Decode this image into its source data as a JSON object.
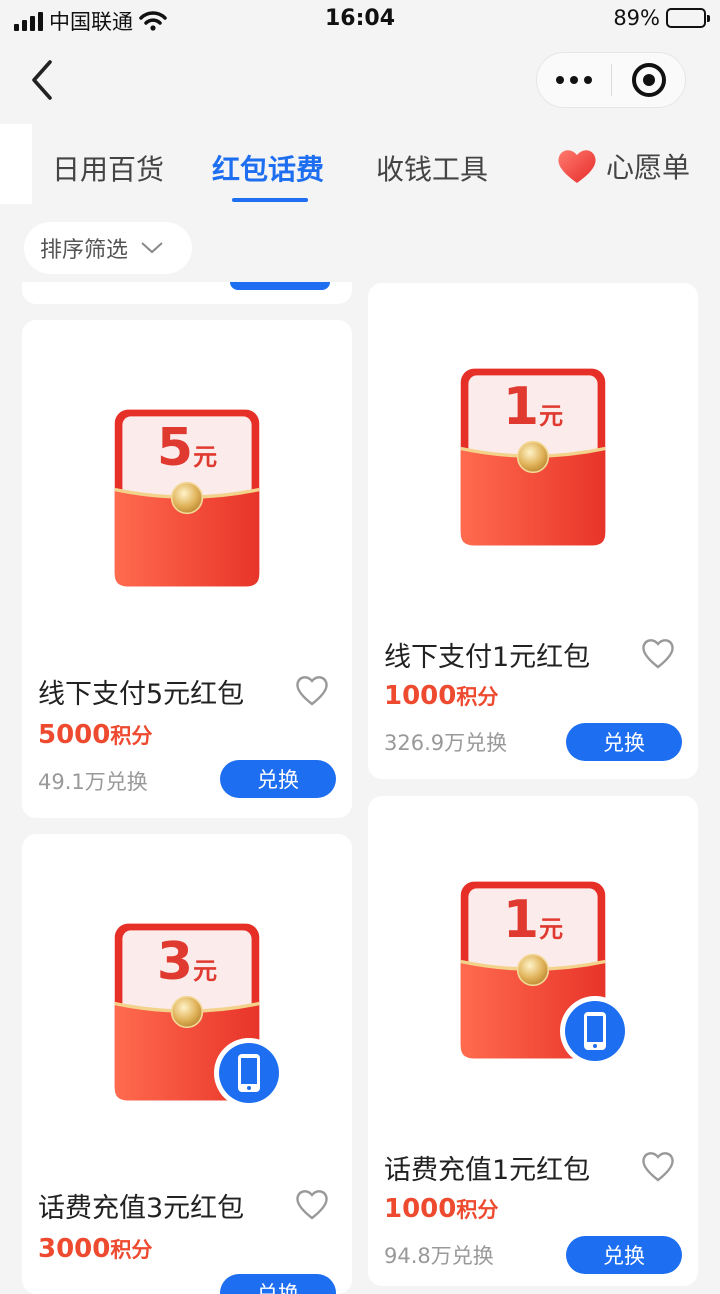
{
  "status": {
    "carrier": "中国联通",
    "time": "16:04",
    "battery": "89%"
  },
  "tabs": [
    {
      "label": "日用百货"
    },
    {
      "label": "红包话费"
    },
    {
      "label": "收钱工具"
    }
  ],
  "wishlist_label": "心愿单",
  "filter_label": "排序筛选",
  "colors": {
    "accent": "#1d6ef0",
    "price": "#ee4a2f"
  },
  "products": [
    {
      "amount": "5",
      "unit": "元",
      "title": "线下支付5元红包",
      "points": "5000",
      "points_unit": "积分",
      "sold": "49.1万兑换",
      "button": "兑换",
      "phone_badge": false
    },
    {
      "amount": "1",
      "unit": "元",
      "title": "线下支付1元红包",
      "points": "1000",
      "points_unit": "积分",
      "sold": "326.9万兑换",
      "button": "兑换",
      "phone_badge": false
    },
    {
      "amount": "3",
      "unit": "元",
      "title": "话费充值3元红包",
      "points": "3000",
      "points_unit": "积分",
      "sold": "",
      "button": "兑换",
      "phone_badge": true
    },
    {
      "amount": "1",
      "unit": "元",
      "title": "话费充值1元红包",
      "points": "1000",
      "points_unit": "积分",
      "sold": "94.8万兑换",
      "button": "兑换",
      "phone_badge": true
    }
  ]
}
